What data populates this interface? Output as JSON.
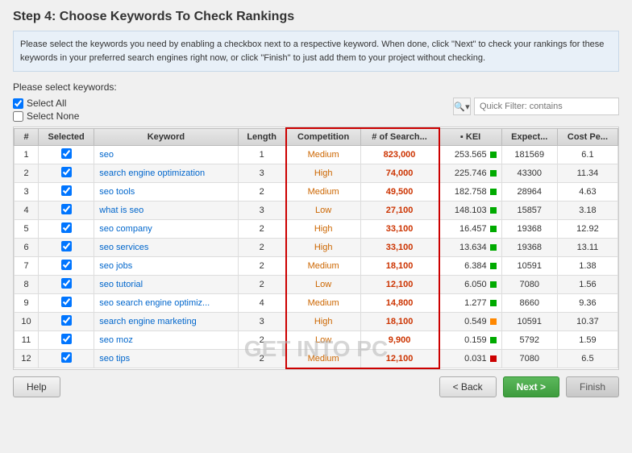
{
  "title": "Step 4: Choose Keywords To Check Rankings",
  "description": "Please select the keywords you need by enabling a checkbox next to a respective keyword. When done, click \"Next\" to check your rankings for these keywords in your preferred search engines right now, or click \"Finish\" to just add them to your project without checking.",
  "select_label": "Please select keywords:",
  "select_all": "Select All",
  "select_none": "Select None",
  "filter_placeholder": "Quick Filter: contains",
  "columns": {
    "num": "#",
    "selected": "Selected",
    "keyword": "Keyword",
    "length": "Length",
    "competition": "Competition",
    "searches": "# of Search...",
    "kei": "▪ KEI",
    "expected": "Expect...",
    "cost": "Cost Pe..."
  },
  "rows": [
    {
      "num": 1,
      "selected": true,
      "keyword": "seo",
      "length": 1,
      "competition": "Medium",
      "searches": "823,000",
      "kei": "253.565",
      "kei_color": "green",
      "expected": 181569,
      "cost": 6.1
    },
    {
      "num": 2,
      "selected": true,
      "keyword": "search engine optimization",
      "length": 3,
      "competition": "High",
      "searches": "74,000",
      "kei": "225.746",
      "kei_color": "green",
      "expected": 43300,
      "cost": 11.34
    },
    {
      "num": 3,
      "selected": true,
      "keyword": "seo tools",
      "length": 2,
      "competition": "Medium",
      "searches": "49,500",
      "kei": "182.758",
      "kei_color": "green",
      "expected": 28964,
      "cost": 4.63
    },
    {
      "num": 4,
      "selected": true,
      "keyword": "what is seo",
      "length": 3,
      "competition": "Low",
      "searches": "27,100",
      "kei": "148.103",
      "kei_color": "green",
      "expected": 15857,
      "cost": 3.18
    },
    {
      "num": 5,
      "selected": true,
      "keyword": "seo company",
      "length": 2,
      "competition": "High",
      "searches": "33,100",
      "kei": "16.457",
      "kei_color": "green",
      "expected": 19368,
      "cost": 12.92
    },
    {
      "num": 6,
      "selected": true,
      "keyword": "seo services",
      "length": 2,
      "competition": "High",
      "searches": "33,100",
      "kei": "13.634",
      "kei_color": "green",
      "expected": 19368,
      "cost": 13.11
    },
    {
      "num": 7,
      "selected": true,
      "keyword": "seo jobs",
      "length": 2,
      "competition": "Medium",
      "searches": "18,100",
      "kei": "6.384",
      "kei_color": "green",
      "expected": 10591,
      "cost": 1.38
    },
    {
      "num": 8,
      "selected": true,
      "keyword": "seo tutorial",
      "length": 2,
      "competition": "Low",
      "searches": "12,100",
      "kei": "6.050",
      "kei_color": "green",
      "expected": 7080,
      "cost": 1.56
    },
    {
      "num": 9,
      "selected": true,
      "keyword": "seo search engine optimiz...",
      "length": 4,
      "competition": "Medium",
      "searches": "14,800",
      "kei": "1.277",
      "kei_color": "green",
      "expected": 8660,
      "cost": 9.36
    },
    {
      "num": 10,
      "selected": true,
      "keyword": "search engine marketing",
      "length": 3,
      "competition": "High",
      "searches": "18,100",
      "kei": "0.549",
      "kei_color": "orange",
      "expected": 10591,
      "cost": 10.37
    },
    {
      "num": 11,
      "selected": true,
      "keyword": "seo moz",
      "length": 2,
      "competition": "Low",
      "searches": "9,900",
      "kei": "0.159",
      "kei_color": "green",
      "expected": 5792,
      "cost": 1.59
    },
    {
      "num": 12,
      "selected": true,
      "keyword": "seo tips",
      "length": 2,
      "competition": "Medium",
      "searches": "12,100",
      "kei": "0.031",
      "kei_color": "red",
      "expected": 7080,
      "cost": 6.5
    }
  ],
  "buttons": {
    "help": "Help",
    "back": "< Back",
    "next": "Next >",
    "finish": "Finish"
  },
  "watermark": "GET INTO PC"
}
